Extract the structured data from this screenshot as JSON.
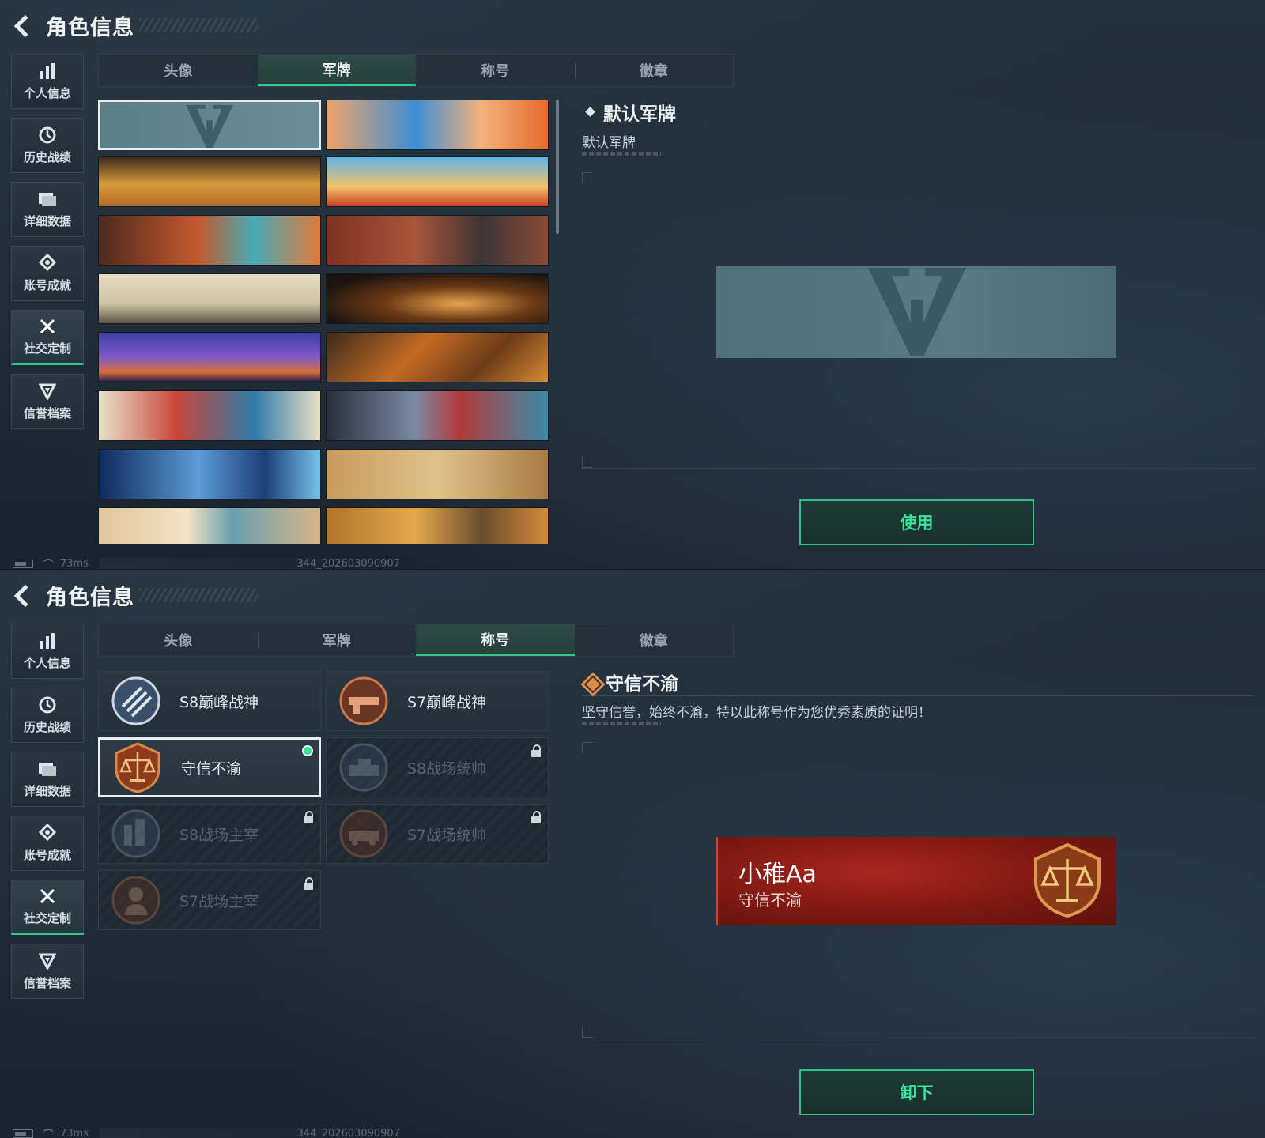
{
  "header": {
    "title": "角色信息"
  },
  "sidebar": {
    "items": [
      {
        "label": "个人信息",
        "icon": "bar-chart-icon"
      },
      {
        "label": "历史战绩",
        "icon": "history-icon"
      },
      {
        "label": "详细数据",
        "icon": "folder-icon"
      },
      {
        "label": "账号成就",
        "icon": "achievement-icon"
      },
      {
        "label": "社交定制",
        "icon": "tools-icon"
      },
      {
        "label": "信誉档案",
        "icon": "shield-icon"
      }
    ],
    "active_index": 4
  },
  "tabs": [
    "头像",
    "军牌",
    "称号",
    "徽章"
  ],
  "panel_badges": {
    "active_tab": "军牌",
    "selected": {
      "name": "默认军牌",
      "description": "默认军牌"
    },
    "banner_count": 16,
    "action_label": "使用"
  },
  "panel_titles": {
    "active_tab": "称号",
    "selected": {
      "name": "守信不渝",
      "description": "坚守信誉，始终不渝，特以此称号作为您优秀素质的证明！"
    },
    "items": [
      {
        "name": "S8巅峰战神",
        "locked": false,
        "equipped": false
      },
      {
        "name": "S7巅峰战神",
        "locked": false,
        "equipped": false
      },
      {
        "name": "守信不渝",
        "locked": false,
        "equipped": true
      },
      {
        "name": "S8战场统帅",
        "locked": true,
        "equipped": false
      },
      {
        "name": "S8战场主宰",
        "locked": true,
        "equipped": false
      },
      {
        "name": "S7战场统帅",
        "locked": true,
        "equipped": false
      },
      {
        "name": "S7战场主宰",
        "locked": true,
        "equipped": false
      }
    ],
    "card": {
      "player_name": "小稚Aa",
      "title": "守信不渝"
    },
    "action_label": "卸下"
  },
  "status": {
    "ping": "73ms",
    "build": "344_202603090907"
  },
  "colors": {
    "accent": "#31c88a",
    "button_text": "#39e39b",
    "title_card": "#8b1c15",
    "rank_icon": "#e08a47"
  }
}
